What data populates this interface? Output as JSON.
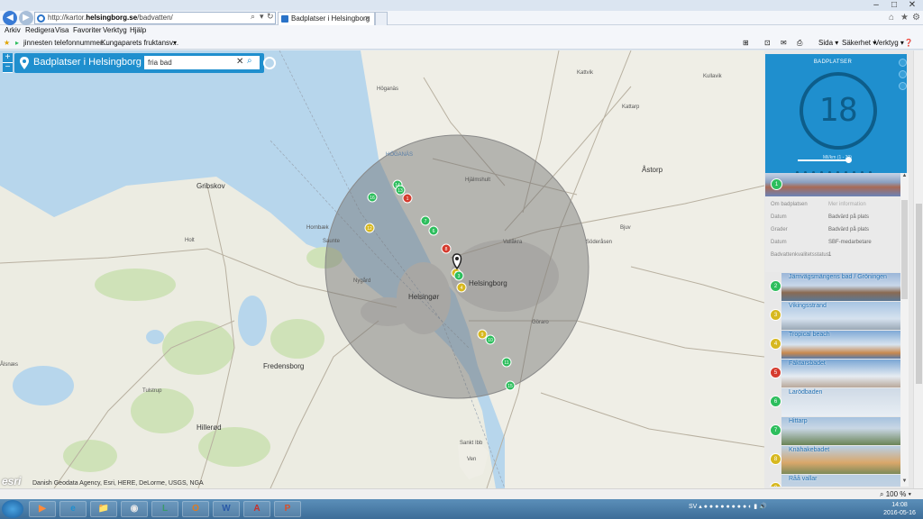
{
  "browser": {
    "address_prefix": "http://kartor.",
    "address_host": "helsingborg.se",
    "address_path": "/badvatten/",
    "tab_title": "Badplatser i Helsingborg",
    "menu": [
      "Arkiv",
      "Redigera",
      "Visa",
      "Favoriter",
      "Verktyg",
      "Hjälp"
    ],
    "favorites": [
      "jinnesten telefonnummer...",
      "Kungaparets fruktansv..."
    ],
    "commands": [
      "Sida ▾",
      "Säkerhet ▾",
      "Verktyg ▾"
    ],
    "zoom": "100 %"
  },
  "search": {
    "title": "Badplatser i Helsingborg",
    "value": "fria bad",
    "zoom_in": "+",
    "zoom_out": "−"
  },
  "map": {
    "attribution": "Danish Geodata Agency, Esri, HERE, DeLorme, USGS, NGA",
    "logo": "esri",
    "labels": [
      {
        "text": "Gribskov",
        "cls": "big"
      },
      {
        "text": "Hornbæk",
        "cls": ""
      },
      {
        "text": "Saunte",
        "cls": ""
      },
      {
        "text": "Helsingør",
        "cls": "big"
      },
      {
        "text": "Helsingborg",
        "cls": "big"
      },
      {
        "text": "HÖGANÄS",
        "cls": "blue"
      },
      {
        "text": "Hjälmshult",
        "cls": ""
      },
      {
        "text": "Vallåkra",
        "cls": ""
      },
      {
        "text": "Fredensborg",
        "cls": "big"
      },
      {
        "text": "Hillerød",
        "cls": "big"
      },
      {
        "text": "Tulstrup",
        "cls": ""
      },
      {
        "text": "Åstorp",
        "cls": "big"
      },
      {
        "text": "Bjuv",
        "cls": ""
      },
      {
        "text": "Göraro",
        "cls": ""
      },
      {
        "text": "Sankt Ibb",
        "cls": ""
      },
      {
        "text": "Ven",
        "cls": ""
      },
      {
        "text": "Nygård",
        "cls": ""
      },
      {
        "text": "Ålsnæs",
        "cls": ""
      },
      {
        "text": "Holt",
        "cls": ""
      },
      {
        "text": "Kattvik",
        "cls": ""
      },
      {
        "text": "Kullavik",
        "cls": ""
      },
      {
        "text": "Söderåsen",
        "cls": ""
      },
      {
        "text": "Kattarp",
        "cls": ""
      },
      {
        "text": "Höganäs",
        "cls": ""
      }
    ],
    "markers": [
      {
        "n": "14",
        "c": "g"
      },
      {
        "n": "13",
        "c": "g"
      },
      {
        "n": "1",
        "c": "r"
      },
      {
        "n": "16",
        "c": "g"
      },
      {
        "n": "7",
        "c": "g"
      },
      {
        "n": "12",
        "c": "y"
      },
      {
        "n": "6",
        "c": "g"
      },
      {
        "n": "8",
        "c": "r"
      },
      {
        "n": "2",
        "c": "y"
      },
      {
        "n": "3",
        "c": "g"
      },
      {
        "n": "4",
        "c": "y"
      },
      {
        "n": "9",
        "c": "y"
      },
      {
        "n": "10",
        "c": "g"
      },
      {
        "n": "11",
        "c": "g"
      },
      {
        "n": "15",
        "c": "g"
      }
    ]
  },
  "panel": {
    "title": "BADPLATSER",
    "count": "18",
    "slider_label": "Mil/km (1 - 30)",
    "selected": {
      "number": "1",
      "color": "g"
    },
    "details": [
      {
        "label": "Om badplatsen",
        "value": "Mer information",
        "link": true
      },
      {
        "label": "Datum",
        "value": "Badvärd på plats",
        "link": false
      },
      {
        "label": "Grader",
        "value": "Badvärd på plats",
        "link": false
      },
      {
        "label": "Datum",
        "value": "SBF-medarbetare",
        "link": false
      },
      {
        "label": "Badvattenkvalitetsstatus",
        "value": "1",
        "link": false
      }
    ],
    "items": [
      {
        "number": "2",
        "color": "g",
        "name": "Jämvägsmängens bad / Gröningen"
      },
      {
        "number": "3",
        "color": "y",
        "name": "Vikingsstrand"
      },
      {
        "number": "4",
        "color": "y",
        "name": "Tropical beach"
      },
      {
        "number": "5",
        "color": "r",
        "name": "Fäktarsbadet"
      },
      {
        "number": "6",
        "color": "g",
        "name": "Larödbaden"
      },
      {
        "number": "7",
        "color": "g",
        "name": "Hittarp"
      },
      {
        "number": "8",
        "color": "y",
        "name": "Knähakebadet"
      },
      {
        "number": "9",
        "color": "y",
        "name": "Råå vallar"
      }
    ]
  },
  "taskbar": {
    "apps": [
      "▶",
      "e",
      "📁",
      "◉",
      "L",
      "O",
      "W",
      "A",
      "P"
    ],
    "tray": "SV",
    "time": "14:08",
    "date": "2016-05-16"
  }
}
